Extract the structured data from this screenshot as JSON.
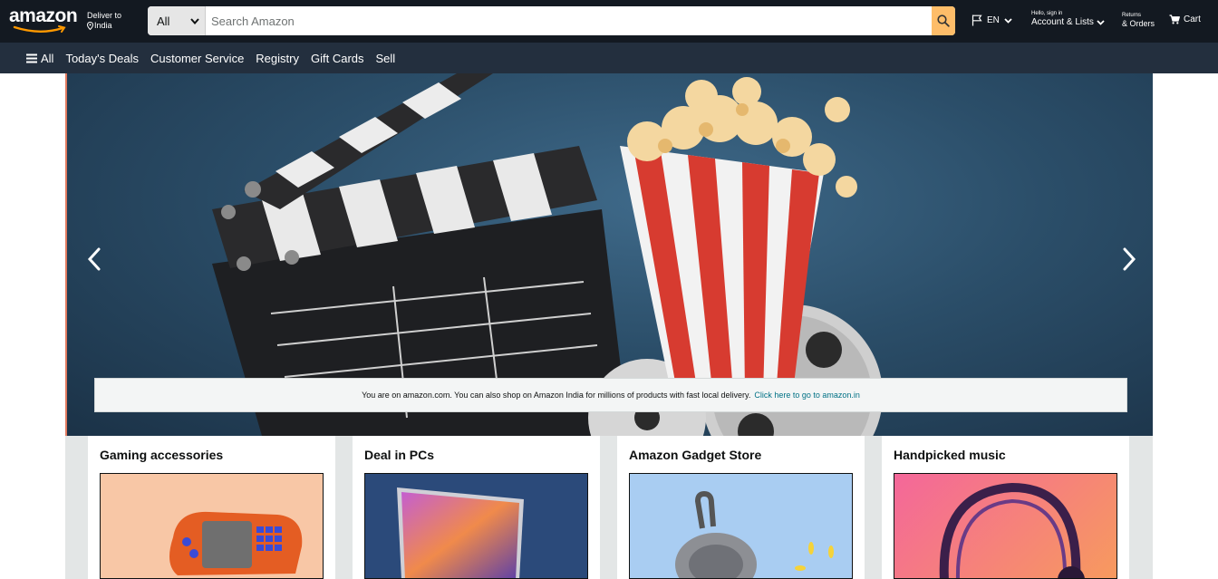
{
  "header": {
    "logo_text": "amazon",
    "deliver_line1": "Deliver to",
    "deliver_line2": "India",
    "search": {
      "category": "All",
      "placeholder": "Search Amazon"
    },
    "language": "EN",
    "account_line1": "Hello, sign in",
    "account_line2": "Account & Lists",
    "orders_line1": "Returns",
    "orders_line2": "& Orders",
    "cart_label": "Cart"
  },
  "subnav": {
    "all_label": "All",
    "items": [
      "Today's Deals",
      "Customer Service",
      "Registry",
      "Gift Cards",
      "Sell"
    ]
  },
  "hero": {
    "notice_text": "You are on amazon.com. You can also shop on Amazon India for millions of products with fast local delivery.",
    "notice_link": "Click here to go to amazon.in"
  },
  "cards": [
    {
      "title": "Gaming accessories"
    },
    {
      "title": "Deal in PCs"
    },
    {
      "title": "Amazon Gadget Store"
    },
    {
      "title": "Handpicked music"
    }
  ],
  "colors": {
    "nav_bg": "#131921",
    "subnav_bg": "#232f3e",
    "search_button": "#febd69",
    "link": "#007185",
    "page_bg": "#e3e6e6"
  },
  "icons": {
    "search": "search-icon",
    "flag": "flag-icon",
    "cart": "cart-icon",
    "menu": "hamburger-icon",
    "location": "location-pin-icon"
  }
}
